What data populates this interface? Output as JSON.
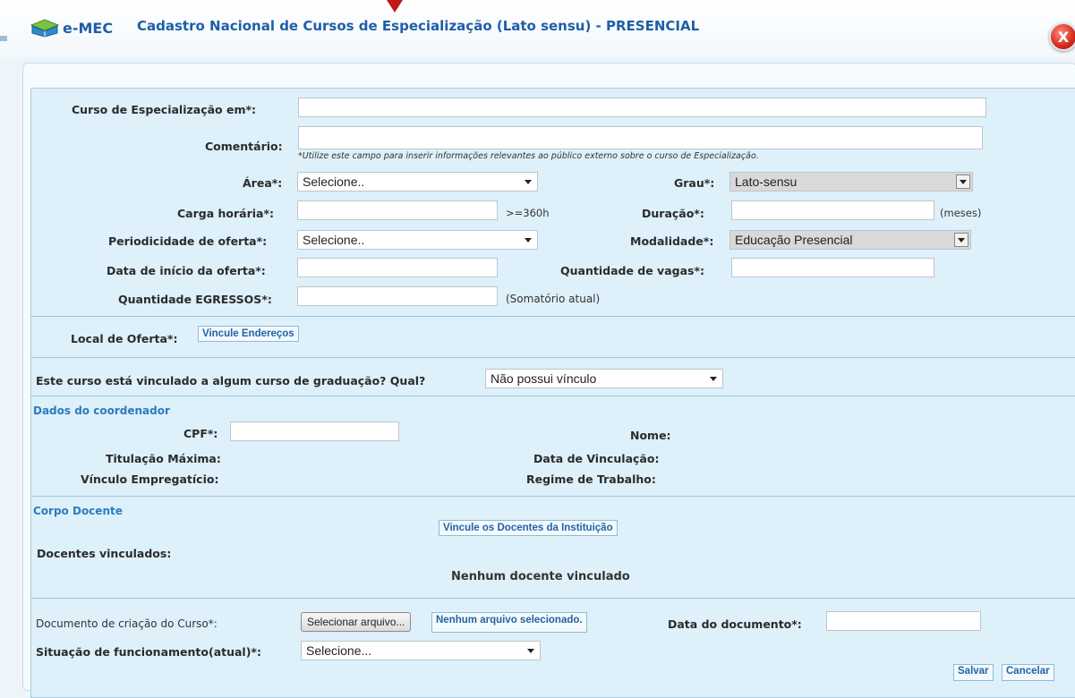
{
  "header": {
    "logo_text": "e-MEC",
    "title": "Cadastro Nacional de Cursos de Especialização (Lato sensu) - PRESENCIAL",
    "close_glyph": "X"
  },
  "form": {
    "curso_label": "Curso de Especialização em*:",
    "curso_value": "",
    "comentario_label": "Comentário:",
    "comentario_hint": "*Utilize este campo para inserir informações relevantes ao público externo sobre o curso de Especialização.",
    "area_label": "Área*:",
    "area_value": "Selecione..",
    "grau_label": "Grau*:",
    "grau_value": "Lato-sensu",
    "carga_label": "Carga horária*:",
    "carga_hint": ">=360h",
    "duracao_label": "Duração*:",
    "duracao_hint": "(meses)",
    "periodicidade_label": "Periodicidade de oferta*:",
    "periodicidade_value": "Selecione..",
    "modalidade_label": "Modalidade*:",
    "modalidade_value": "Educação Presencial",
    "data_inicio_label": "Data de início da oferta*:",
    "vagas_label": "Quantidade de vagas*:",
    "egressos_label": "Quantidade EGRESSOS*:",
    "egressos_hint": "(Somatório atual)",
    "local_label": "Local de Oferta*:",
    "local_button": "Vincule Endereços",
    "vinculo_label": "Este curso está vinculado a algum curso de graduação? Qual?",
    "vinculo_value": "Não possui vínculo"
  },
  "coordenador": {
    "section_title": "Dados do coordenador",
    "cpf_label": "CPF*:",
    "nome_label": "Nome:",
    "titulacao_label": "Titulação Máxima:",
    "data_vinculacao_label": "Data de Vinculação:",
    "vinculo_empregaticio_label": "Vínculo Empregatício:",
    "regime_label": "Regime de Trabalho:"
  },
  "docentes": {
    "section_title": "Corpo Docente",
    "vincule_button": "Vincule os Docentes da Instituição",
    "vinculados_label": "Docentes vinculados:",
    "empty_text": "Nenhum docente vinculado"
  },
  "documento": {
    "label": "Documento de criação do Curso*:",
    "file_button": "Selecionar arquivo...",
    "file_status": "Nenhum arquivo selecionado.",
    "data_label": "Data do documento*:",
    "situacao_label": "Situação de funcionamento(atual)*:",
    "situacao_value": "Selecione..."
  },
  "actions": {
    "save": "Salvar",
    "cancel": "Cancelar"
  }
}
